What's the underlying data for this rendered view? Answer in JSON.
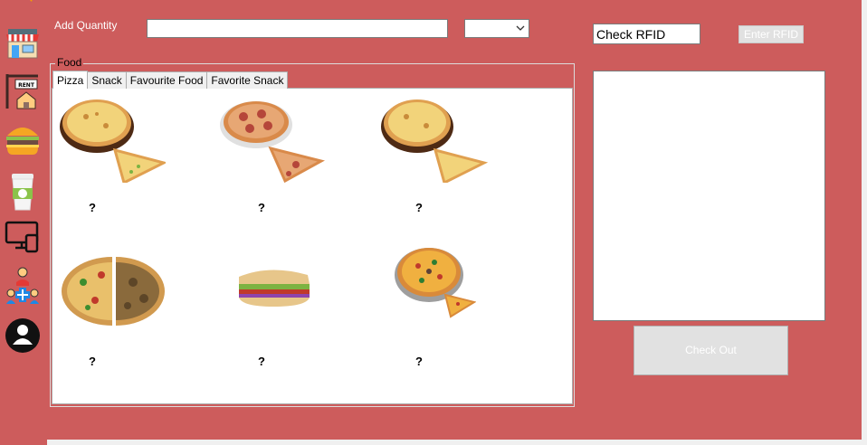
{
  "sidebar": {
    "icons": [
      "logo-icon",
      "store-icon",
      "rent-icon",
      "burger-icon",
      "coffee-cup-icon",
      "devices-icon",
      "medical-team-icon",
      "user-icon"
    ],
    "rent_text": "RENT"
  },
  "order": {
    "quantity_label": "Add Quantity",
    "quantity_value": "",
    "unit_selected": ""
  },
  "rfid": {
    "field_value": "Check RFID",
    "button_label": "Enter RFID"
  },
  "food_group": {
    "title": "Food",
    "tabs": [
      {
        "label": "Pizza"
      },
      {
        "label": "Snack"
      },
      {
        "label": "Favourite Food"
      },
      {
        "label": "Favorite Snack"
      }
    ],
    "items": [
      {
        "label": "?",
        "icon": "pizza-board-icon"
      },
      {
        "label": "?",
        "icon": "pepperoni-pizza-icon"
      },
      {
        "label": "?",
        "icon": "pizza-board-icon"
      },
      {
        "label": "?",
        "icon": "mixed-pizza-icon"
      },
      {
        "label": "?",
        "icon": "sub-sandwich-icon"
      },
      {
        "label": "?",
        "icon": "supreme-pizza-icon"
      }
    ]
  },
  "checkout": {
    "button_label": "Check Out"
  },
  "colors": {
    "background": "#cd5c5c",
    "panel": "#ffffff",
    "disabled_button": "#e1e1e1"
  }
}
